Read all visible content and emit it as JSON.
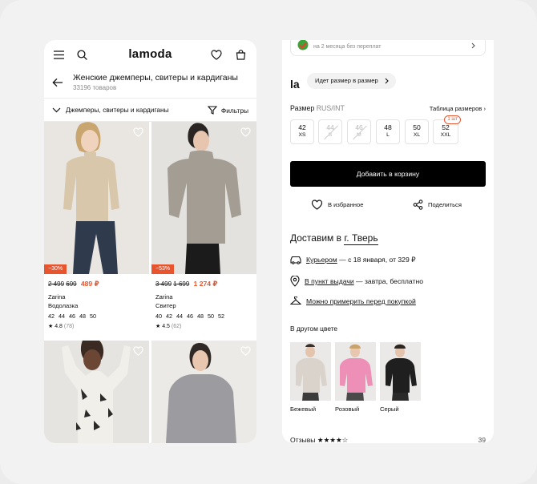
{
  "catalog": {
    "logo": "lamoda",
    "title": "Женские джемперы, свитеры и кардиганы",
    "count": "33196 товаров",
    "filter_category": "Джемперы, свитеры и кардиганы",
    "filter_button": "Фильтры",
    "products": [
      {
        "discount": "−30%",
        "old_price": "2 499",
        "mid_price": "699",
        "new_price": "489 ₽",
        "brand": "Zarina",
        "type": "Водолазка",
        "sizes": "42 44 46 48 50",
        "rating": "★ 4.8",
        "rating_count": "(78)",
        "colors": {
          "bg": "#e9e6e2",
          "garment": "#d8c7ab",
          "pants": "#2f3a4d"
        }
      },
      {
        "discount": "−53%",
        "old_price": "3 499",
        "mid_price": "1 699",
        "new_price": "1 274 ₽",
        "brand": "Zarina",
        "type": "Свитер",
        "sizes": "40 42 44 46 48 50 52",
        "rating": "★ 4.5",
        "rating_count": "(62)",
        "colors": {
          "bg": "#e4e2de",
          "garment": "#a49d94",
          "pants": "#1b1b1b"
        }
      },
      {
        "colors": {
          "bg": "#e6e4e0",
          "garment": "#f1efea",
          "pants": "#2a2a2a"
        }
      },
      {
        "colors": {
          "bg": "#eceae6",
          "garment": "#9c9ca0",
          "pants": "#3a3a3a"
        }
      }
    ]
  },
  "product": {
    "bank_text": "на 2 месяца без переплат",
    "brand_short": "la",
    "fit_label": "Идет размер в размер",
    "size_label": "Размер",
    "size_system": "RUS/INT",
    "size_table": "Таблица размеров",
    "sizes": [
      {
        "num": "42",
        "letter": "XS",
        "available": true
      },
      {
        "num": "44",
        "letter": "S",
        "available": false
      },
      {
        "num": "46",
        "letter": "M",
        "available": false
      },
      {
        "num": "48",
        "letter": "L",
        "available": true
      },
      {
        "num": "50",
        "letter": "XL",
        "available": true
      },
      {
        "num": "52",
        "letter": "XXL",
        "available": true,
        "badge": "1 шт"
      }
    ],
    "add_to_cart": "Добавить в корзину",
    "favorites": "В избранное",
    "share": "Поделиться",
    "deliver_prefix": "Доставим в",
    "city": "г. Тверь",
    "delivery": [
      {
        "icon": "car-icon",
        "link": "Курьером",
        "text": " — с 18 января, от 329 ₽"
      },
      {
        "icon": "pin-icon",
        "link": "В пункт выдачи",
        "text": " — завтра, бесплатно"
      },
      {
        "icon": "hanger-icon",
        "link": "Можно примерить перед покупкой",
        "text": ""
      }
    ],
    "other_colors_label": "В другом цвете",
    "other_colors": [
      {
        "label": "Бежевый",
        "color": "#d9d3cb"
      },
      {
        "label": "Розовый",
        "color": "#ee8fb8"
      },
      {
        "label": "Серый",
        "color": "#1f1f1f"
      }
    ],
    "reviews_label": "Отзывы ★★★★☆",
    "reviews_count": "39"
  }
}
